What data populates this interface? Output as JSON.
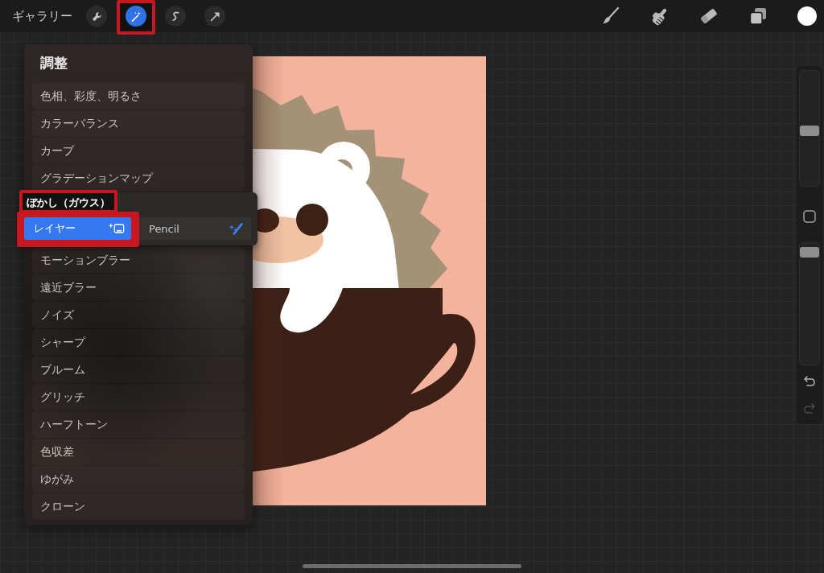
{
  "top_bar": {
    "gallery_label": "ギャラリー",
    "left_tools": [
      {
        "kind": "wrench",
        "selected": false,
        "highlighted": false
      },
      {
        "kind": "wand",
        "selected": true,
        "highlighted": true
      },
      {
        "kind": "selection",
        "selected": false,
        "highlighted": false
      },
      {
        "kind": "transform",
        "selected": false,
        "highlighted": false
      }
    ],
    "right_tools": [
      {
        "kind": "brush",
        "selected": false
      },
      {
        "kind": "smudge",
        "selected": false
      },
      {
        "kind": "eraser",
        "selected": false
      },
      {
        "kind": "layers",
        "selected": false
      }
    ]
  },
  "adjustments_menu": {
    "title": "調整",
    "items": [
      {
        "kind": "item",
        "label": "色相、彩度、明るさ"
      },
      {
        "kind": "item",
        "label": "カラーバランス"
      },
      {
        "kind": "item",
        "label": "カーブ"
      },
      {
        "kind": "item",
        "label": "グラデーションマップ"
      },
      {
        "kind": "choice",
        "label": "ぼかし（ガウス）",
        "highlighted": true,
        "options": [
          {
            "kind": "layer",
            "label": "レイヤー",
            "selected": true,
            "highlighted": true
          },
          {
            "kind": "pencil",
            "label": "Pencil",
            "selected": false,
            "highlighted": false
          }
        ]
      },
      {
        "kind": "item",
        "label": "モーションブラー"
      },
      {
        "kind": "item",
        "label": "遠近ブラー"
      },
      {
        "kind": "item",
        "label": "ノイズ"
      },
      {
        "kind": "item",
        "label": "シャープ"
      },
      {
        "kind": "item",
        "label": "ブルーム"
      },
      {
        "kind": "item",
        "label": "グリッチ"
      },
      {
        "kind": "item",
        "label": "ハーフトーン"
      },
      {
        "kind": "item",
        "label": "色収差"
      },
      {
        "kind": "item",
        "label": "ゆがみ"
      },
      {
        "kind": "item",
        "label": "クローン"
      }
    ]
  },
  "sidebar": {
    "sliders": [
      {
        "kind": "size",
        "level": 0.48
      },
      {
        "kind": "opacity",
        "level": 0.96
      }
    ],
    "actions": [
      {
        "kind": "undo",
        "disabled": false
      },
      {
        "kind": "redo",
        "disabled": true
      }
    ]
  }
}
